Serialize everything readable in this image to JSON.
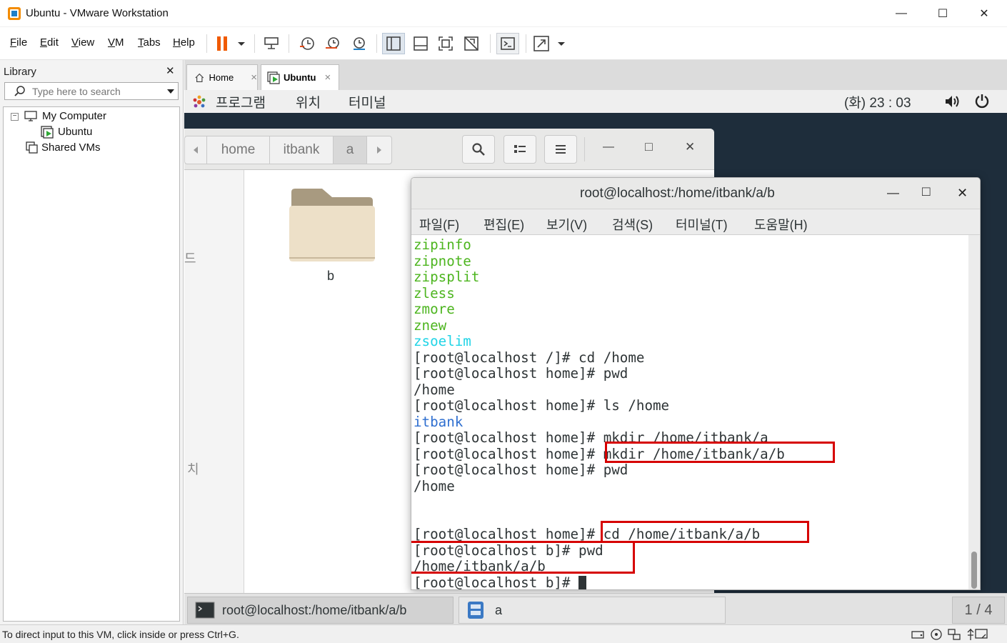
{
  "window": {
    "title": "Ubuntu - VMware Workstation",
    "minimize": "—",
    "maximize": "☐",
    "close": "✕"
  },
  "menu": {
    "items": [
      {
        "label": "File",
        "key": "F",
        "rest": "ile"
      },
      {
        "label": "Edit",
        "key": "E",
        "rest": "dit"
      },
      {
        "label": "View",
        "key": "V",
        "rest": "iew"
      },
      {
        "label": "VM",
        "key": "V",
        "rest": "M"
      },
      {
        "label": "Tabs",
        "key": "T",
        "rest": "abs"
      },
      {
        "label": "Help",
        "key": "H",
        "rest": "elp"
      }
    ]
  },
  "library": {
    "title": "Library",
    "close": "✕",
    "search_placeholder": "Type here to search",
    "tree": {
      "my_computer": "My Computer",
      "ubuntu": "Ubuntu",
      "shared_vms": "Shared VMs",
      "collapse": "−"
    }
  },
  "tabs": [
    {
      "label": "Home",
      "close": "×"
    },
    {
      "label": "Ubuntu",
      "close": "×"
    }
  ],
  "gnome": {
    "programs": "프로그램",
    "places": "위치",
    "terminal": "터미널",
    "clock": "(화) 23 : 03"
  },
  "nautilus": {
    "crumbs": [
      "home",
      "itbank",
      "a"
    ],
    "folder_name": "b",
    "side_fragment_1": "드",
    "side_fragment_2": "치",
    "minimize": "—",
    "maximize": "□",
    "close": "✕"
  },
  "terminal": {
    "title": "root@localhost:/home/itbank/a/b",
    "minimize": "—",
    "maximize": "□",
    "close": "✕",
    "menu": [
      "파일(F)",
      "편집(E)",
      "보기(V)",
      "검색(S)",
      "터미널(T)",
      "도움말(H)"
    ],
    "lines": [
      "zipinfo",
      "zipnote",
      "zipsplit",
      "zless",
      "zmore",
      "znew",
      "zsoelim",
      "[root@localhost /]# cd /home",
      "[root@localhost home]# pwd",
      "/home",
      "[root@localhost home]# ls /home",
      "itbank",
      "[root@localhost home]# mkdir /home/itbank/a",
      "[root@localhost home]# mkdir /home/itbank/a/b",
      "[root@localhost home]# pwd",
      "/home",
      "",
      "",
      "[root@localhost home]# cd /home/itbank/a/b",
      "[root@localhost b]# pwd",
      "/home/itbank/a/b",
      "[root@localhost b]# "
    ],
    "colors": {
      "green": "#4db51f",
      "cyan": "#21d4e6",
      "blue": "#2f6fd0",
      "highlight": "#d60000"
    }
  },
  "taskbar": {
    "items": [
      {
        "label": "root@localhost:/home/itbank/a/b"
      },
      {
        "label": "a"
      }
    ],
    "workspace": "1 / 4"
  },
  "status": {
    "text": "To direct input to this VM, click inside or press Ctrl+G."
  }
}
